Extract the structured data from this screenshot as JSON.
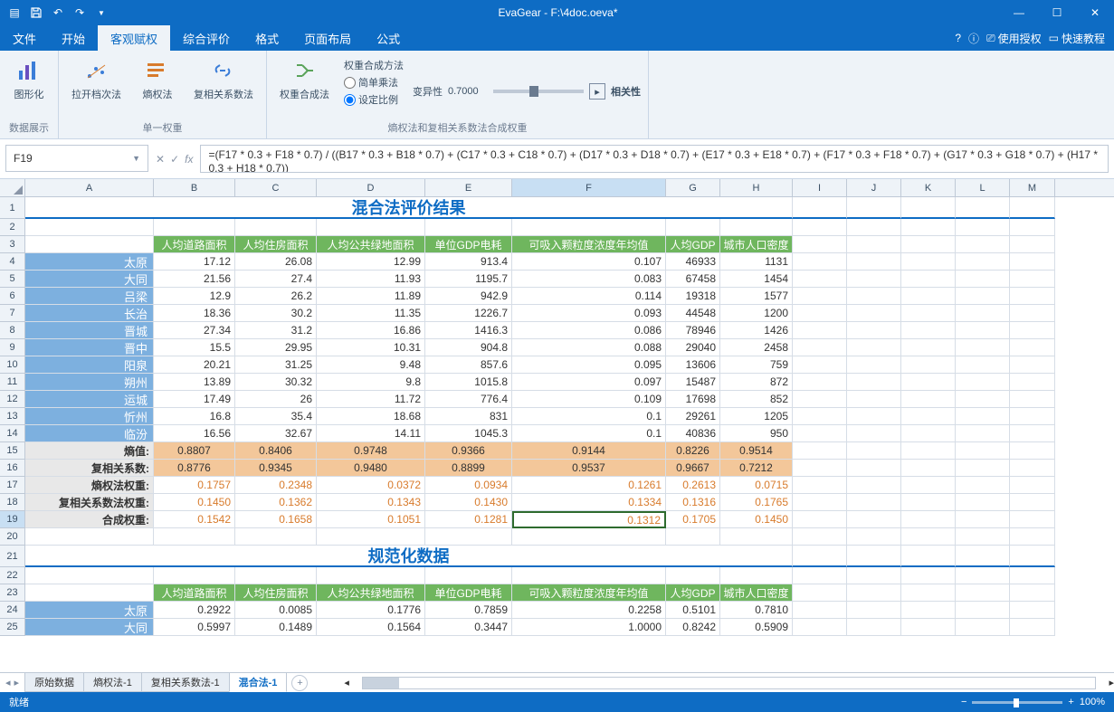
{
  "app": {
    "title": "EvaGear  -  F:\\4doc.oeva*"
  },
  "menus": {
    "file": "文件",
    "start": "开始",
    "objw": "客观赋权",
    "eval": "综合评价",
    "fmt": "格式",
    "layout": "页面布局",
    "formula": "公式"
  },
  "topright": {
    "help": "?",
    "info": "ⓘ",
    "auth_icon": "⎚",
    "auth": "使用授权",
    "tut_icon": "▭",
    "tut": "快速教程"
  },
  "ribbon": {
    "g1": {
      "btn1": "图形化",
      "label": "数据展示"
    },
    "g2": {
      "btn1": "拉开档次法",
      "btn2": "熵权法",
      "btn3": "复相关系数法",
      "label": "单一权重"
    },
    "g3": {
      "btn1": "权重合成法",
      "form_title": "权重合成方法",
      "r1": "简单乘法",
      "r2": "设定比例",
      "varlabel": "变异性",
      "varval": "0.7000",
      "rel": "相关性",
      "label": "熵权法和复相关系数法合成权重"
    }
  },
  "formula": {
    "namebox": "F19",
    "text": "=(F17 * 0.3 + F18 * 0.7) / ((B17 * 0.3 + B18 * 0.7) + (C17 * 0.3 + C18 * 0.7) + (D17 * 0.3 + D18 * 0.7) + (E17 * 0.3 + E18 * 0.7) + (F17 * 0.3 + F18 * 0.7) + (G17 * 0.3 + G18 * 0.7) + (H17 * 0.3 + H18 * 0.7))"
  },
  "cols": [
    "A",
    "B",
    "C",
    "D",
    "E",
    "F",
    "G",
    "H",
    "I",
    "J",
    "K",
    "L",
    "M"
  ],
  "section1_title": "混合法评价结果",
  "section2_title": "规范化数据",
  "headers": [
    "人均道路面积",
    "人均住房面积",
    "人均公共绿地面积",
    "单位GDP电耗",
    "可吸入颗粒度浓度年均值",
    "人均GDP",
    "城市人口密度"
  ],
  "cities": [
    "太原",
    "大同",
    "吕梁",
    "长治",
    "晋城",
    "晋中",
    "阳泉",
    "朔州",
    "运城",
    "忻州",
    "临汾"
  ],
  "data": [
    [
      "17.12",
      "26.08",
      "12.99",
      "913.4",
      "0.107",
      "46933",
      "1131"
    ],
    [
      "21.56",
      "27.4",
      "11.93",
      "1195.7",
      "0.083",
      "67458",
      "1454"
    ],
    [
      "12.9",
      "26.2",
      "11.89",
      "942.9",
      "0.114",
      "19318",
      "1577"
    ],
    [
      "18.36",
      "30.2",
      "11.35",
      "1226.7",
      "0.093",
      "44548",
      "1200"
    ],
    [
      "27.34",
      "31.2",
      "16.86",
      "1416.3",
      "0.086",
      "78946",
      "1426"
    ],
    [
      "15.5",
      "29.95",
      "10.31",
      "904.8",
      "0.088",
      "29040",
      "2458"
    ],
    [
      "20.21",
      "31.25",
      "9.48",
      "857.6",
      "0.095",
      "13606",
      "759"
    ],
    [
      "13.89",
      "30.32",
      "9.8",
      "1015.8",
      "0.097",
      "15487",
      "872"
    ],
    [
      "17.49",
      "26",
      "11.72",
      "776.4",
      "0.109",
      "17698",
      "852"
    ],
    [
      "16.8",
      "35.4",
      "18.68",
      "831",
      "0.1",
      "29261",
      "1205"
    ],
    [
      "16.56",
      "32.67",
      "14.11",
      "1045.3",
      "0.1",
      "40836",
      "950"
    ]
  ],
  "summaries": {
    "r15": {
      "label": "熵值:",
      "vals": [
        "0.8807",
        "0.8406",
        "0.9748",
        "0.9366",
        "0.9144",
        "0.8226",
        "0.9514"
      ]
    },
    "r16": {
      "label": "复相关系数:",
      "vals": [
        "0.8776",
        "0.9345",
        "0.9480",
        "0.8899",
        "0.9537",
        "0.9667",
        "0.7212"
      ]
    },
    "r17": {
      "label": "熵权法权重:",
      "vals": [
        "0.1757",
        "0.2348",
        "0.0372",
        "0.0934",
        "0.1261",
        "0.2613",
        "0.0715"
      ]
    },
    "r18": {
      "label": "复相关系数法权重:",
      "vals": [
        "0.1450",
        "0.1362",
        "0.1343",
        "0.1430",
        "0.1334",
        "0.1316",
        "0.1765"
      ]
    },
    "r19": {
      "label": "合成权重:",
      "vals": [
        "0.1542",
        "0.1658",
        "0.1051",
        "0.1281",
        "0.1312",
        "0.1705",
        "0.1450"
      ]
    }
  },
  "norm": [
    {
      "city": "太原",
      "vals": [
        "0.2922",
        "0.0085",
        "0.1776",
        "0.7859",
        "0.2258",
        "0.5101",
        "0.7810"
      ]
    },
    {
      "city": "大同",
      "vals": [
        "0.5997",
        "0.1489",
        "0.1564",
        "0.3447",
        "1.0000",
        "0.8242",
        "0.5909"
      ]
    }
  ],
  "tabs": [
    "原始数据",
    "熵权法-1",
    "复相关系数法-1",
    "混合法-1"
  ],
  "status": {
    "ready": "就绪",
    "zoom": "100%"
  }
}
